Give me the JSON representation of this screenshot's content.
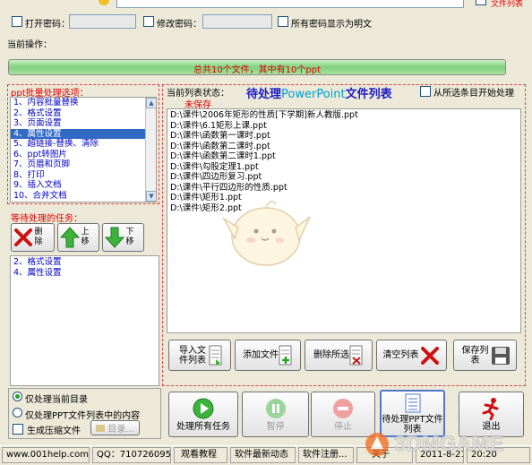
{
  "top": {
    "open_password_label": "打开密码：",
    "modify_password_label": "修改密码：",
    "show_plaintext_label": "所有密码显示为明文",
    "corner_label": "文件列表",
    "current_operation_label": "当前操作："
  },
  "progress": {
    "text": "总共10个文件，其中有10个ppt",
    "fraction": 1.0
  },
  "options": {
    "title": "ppt批量处理选项：",
    "items": [
      "1、内容批量替换",
      "2、格式设置",
      "3、页面设置",
      "4、属性设置",
      "5、超链接-替换、清除",
      "6、ppt转图片",
      "7、页眉和页脚",
      "8、打印",
      "9、插入文档",
      "10、合并文档"
    ],
    "selected_index": 3
  },
  "pending": {
    "title": "等待处理的任务：",
    "delete_label": "删除",
    "up_label": "上移",
    "down_label": "下移",
    "items": [
      "2、格式设置",
      "4、属性设置"
    ]
  },
  "file_panel": {
    "status_label": "当前列表状态：",
    "status_value": "未保存",
    "title_prefix": "待处理",
    "title_brand": "PowerPoint",
    "title_suffix": "文件列表",
    "start_from_selected_label": "从所选条目开始处理",
    "files": [
      "D:\\课件\\2006年矩形的性质[下学期]新人教版.ppt",
      "D:\\课件\\6.1矩形上课.ppt",
      "D:\\课件\\函数第一课时.ppt",
      "D:\\课件\\函数第二课时.ppt",
      "D:\\课件\\函数第二课时1.ppt",
      "D:\\课件\\勾股定理1.ppt",
      "D:\\课件\\四边形复习.ppt",
      "D:\\课件\\平行四边形的性质.ppt",
      "D:\\课件\\矩形1.ppt",
      "D:\\课件\\矩形2.ppt"
    ]
  },
  "file_buttons": {
    "import": "导入文件列表",
    "add": "添加文件",
    "delete_selected": "删除所选",
    "clear": "清空列表",
    "save": "保存列表"
  },
  "options_bottom": {
    "radio_current_dir": "仅处理当前目录",
    "radio_list_content": "仅处理PPT文件列表中的内容",
    "compress_label": "生成压缩文件",
    "dir_button": "目录..."
  },
  "actions": {
    "process_all": "处理所有任务",
    "pause": "暂停",
    "stop": "停止",
    "file_list": "待处理PPT文件列表",
    "exit": "退出"
  },
  "statusbar": {
    "website": "www.001help.com",
    "qq": "QQ：710726095",
    "tutorial": "观看教程",
    "news": "软件最新动态",
    "register": "软件注册...",
    "about": "关于",
    "date": "2011-8-21",
    "time": "20:20"
  },
  "watermark": "3DMGAME"
}
